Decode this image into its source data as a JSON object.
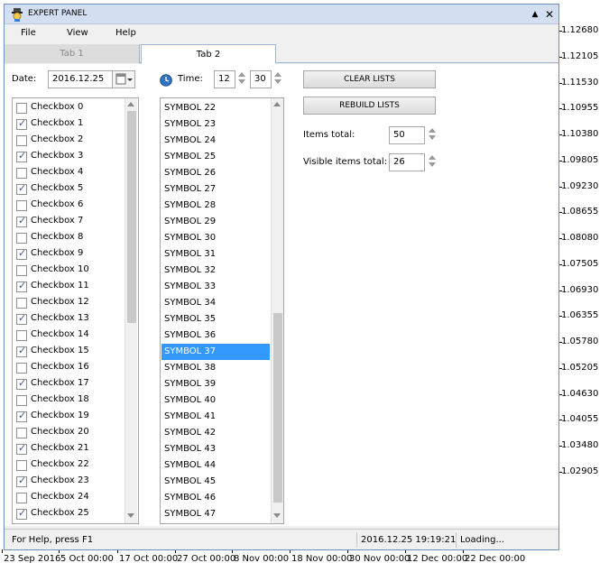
{
  "window": {
    "title": "EXPERT PANEL",
    "minimize_glyph": "▲",
    "close_glyph": "✕"
  },
  "menu": [
    "File",
    "View",
    "Help"
  ],
  "tabs": [
    "Tab 1",
    "Tab 2"
  ],
  "date": {
    "label": "Date:",
    "value": "2016.12.25"
  },
  "time": {
    "label": "Time:",
    "hour": "12",
    "minute": "30"
  },
  "checkboxes": [
    {
      "label": "Checkbox 0",
      "checked": false
    },
    {
      "label": "Checkbox 1",
      "checked": true
    },
    {
      "label": "Checkbox 2",
      "checked": false
    },
    {
      "label": "Checkbox 3",
      "checked": true
    },
    {
      "label": "Checkbox 4",
      "checked": false
    },
    {
      "label": "Checkbox 5",
      "checked": true
    },
    {
      "label": "Checkbox 6",
      "checked": false
    },
    {
      "label": "Checkbox 7",
      "checked": true
    },
    {
      "label": "Checkbox 8",
      "checked": false
    },
    {
      "label": "Checkbox 9",
      "checked": true
    },
    {
      "label": "Checkbox 10",
      "checked": false
    },
    {
      "label": "Checkbox 11",
      "checked": true
    },
    {
      "label": "Checkbox 12",
      "checked": false
    },
    {
      "label": "Checkbox 13",
      "checked": true
    },
    {
      "label": "Checkbox 14",
      "checked": false
    },
    {
      "label": "Checkbox 15",
      "checked": true
    },
    {
      "label": "Checkbox 16",
      "checked": false
    },
    {
      "label": "Checkbox 17",
      "checked": true
    },
    {
      "label": "Checkbox 18",
      "checked": false
    },
    {
      "label": "Checkbox 19",
      "checked": true
    },
    {
      "label": "Checkbox 20",
      "checked": false
    },
    {
      "label": "Checkbox 21",
      "checked": true
    },
    {
      "label": "Checkbox 22",
      "checked": false
    },
    {
      "label": "Checkbox 23",
      "checked": true
    },
    {
      "label": "Checkbox 24",
      "checked": false
    },
    {
      "label": "Checkbox 25",
      "checked": true
    }
  ],
  "symbols": {
    "items": [
      "SYMBOL 22",
      "SYMBOL 23",
      "SYMBOL 24",
      "SYMBOL 25",
      "SYMBOL 26",
      "SYMBOL 27",
      "SYMBOL 28",
      "SYMBOL 29",
      "SYMBOL 30",
      "SYMBOL 31",
      "SYMBOL 32",
      "SYMBOL 33",
      "SYMBOL 34",
      "SYMBOL 35",
      "SYMBOL 36",
      "SYMBOL 37",
      "SYMBOL 38",
      "SYMBOL 39",
      "SYMBOL 40",
      "SYMBOL 41",
      "SYMBOL 42",
      "SYMBOL 43",
      "SYMBOL 44",
      "SYMBOL 45",
      "SYMBOL 46",
      "SYMBOL 47"
    ],
    "selected": "SYMBOL 37"
  },
  "buttons": {
    "clear_lists": "CLEAR LISTS",
    "rebuild_lists": "REBUILD LISTS"
  },
  "items_total": {
    "label": "Items total:",
    "value": "50"
  },
  "visible_items_total": {
    "label": "Visible items total:",
    "value": "26"
  },
  "status": {
    "help": "For Help, press F1",
    "datetime": "2016.12.25 19:19:21",
    "state": "Loading..."
  },
  "price_axis": [
    "1.12680",
    "1.12105",
    "1.11530",
    "1.10955",
    "1.10380",
    "1.09805",
    "1.09230",
    "1.08655",
    "1.08080",
    "1.07505",
    "1.06930",
    "1.06355",
    "1.05780",
    "1.05205",
    "1.04630",
    "1.04055",
    "1.03480",
    "1.02905"
  ],
  "time_axis": [
    "23 Sep 2016",
    "5 Oct 00:00",
    "17 Oct 00:00",
    "27 Oct 00:00",
    "8 Nov 00:00",
    "18 Nov 00:00",
    "30 Nov 00:00",
    "12 Dec 00:00",
    "22 Dec 00:00"
  ],
  "colors": {
    "selection": "#3399ff",
    "title_bar": "#d3def0",
    "check": "#3b5998"
  }
}
